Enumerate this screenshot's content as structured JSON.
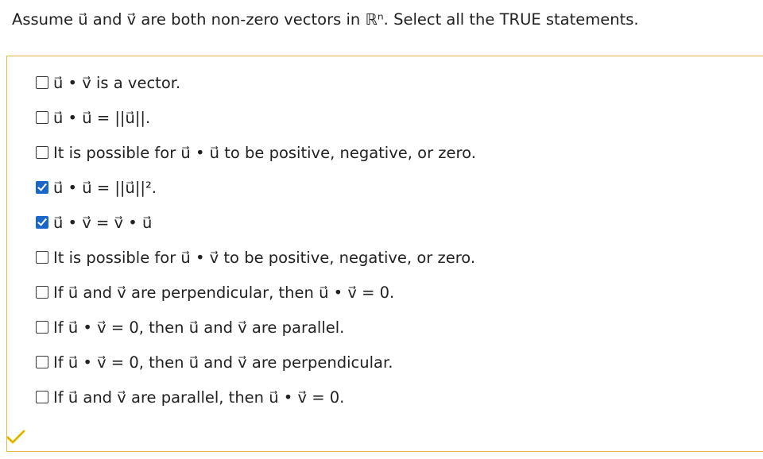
{
  "prompt": "Assume u⃗ and v⃗ are both non-zero vectors in ℝⁿ. Select all the TRUE statements.",
  "options": [
    {
      "text": "u⃗ • v⃗ is a vector.",
      "checked": false
    },
    {
      "text": "u⃗ • u⃗ = ||u⃗||.",
      "checked": false
    },
    {
      "text": "It is possible for u⃗ • u⃗ to be positive, negative, or zero.",
      "checked": false
    },
    {
      "text": "u⃗ • u⃗ = ||u⃗||².",
      "checked": true
    },
    {
      "text": "u⃗ • v⃗ = v⃗ • u⃗",
      "checked": true
    },
    {
      "text": "It is possible for u⃗ • v⃗ to be positive, negative, or zero.",
      "checked": false
    },
    {
      "text": "If u⃗ and v⃗ are perpendicular, then u⃗ • v⃗ = 0.",
      "checked": false
    },
    {
      "text": "If u⃗ • v⃗ = 0, then u⃗ and v⃗ are parallel.",
      "checked": false
    },
    {
      "text": "If u⃗ • v⃗ = 0, then u⃗ and v⃗ are perpendicular.",
      "checked": false
    },
    {
      "text": "If u⃗ and v⃗ are parallel, then u⃗ • v⃗ = 0.",
      "checked": false
    }
  ],
  "colors": {
    "box_border": "#e8b84a",
    "checkbox_checked": "#1a67c9",
    "correct_mark": "#e8c200"
  },
  "icons": {
    "result": "check-icon"
  }
}
